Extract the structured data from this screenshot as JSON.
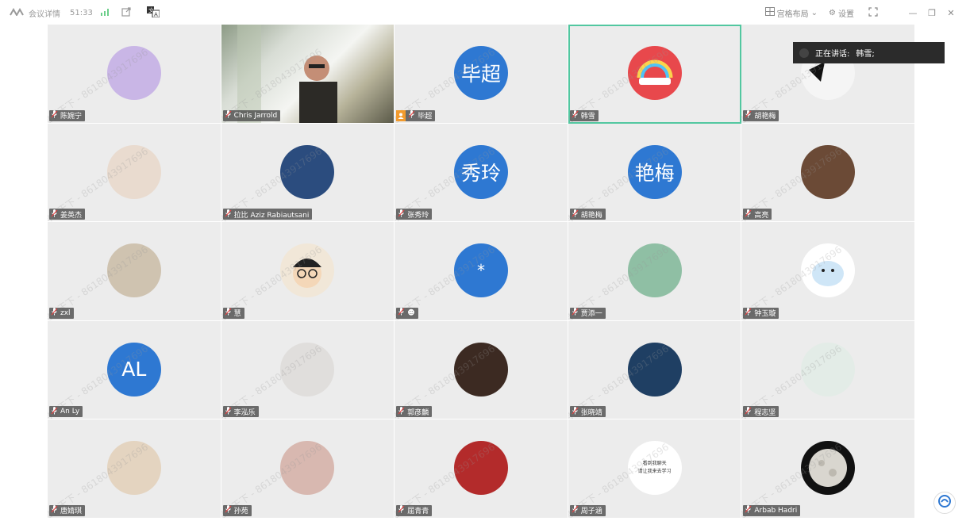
{
  "titlebar": {
    "meeting_info_label": "会议详情",
    "timer": "51:33",
    "layout_label": "宫格布局",
    "settings_label": "设置"
  },
  "speaking": {
    "label": "正在讲话:",
    "name": "韩雪;"
  },
  "watermark": "君悦天下 - 8618043917696",
  "tiles": [
    {
      "name": "陈婉宁",
      "avatar": "avatar-illustration-purple-hair",
      "color": "#c9b6e6"
    },
    {
      "name": "Chris Jarrold",
      "avatar": "camera-video",
      "color": "#8d9b86"
    },
    {
      "name": "毕超",
      "avatar_text": "毕超",
      "color": "#2e78d2",
      "host": true
    },
    {
      "name": "韩雪",
      "avatar": "avatar-rainbow",
      "color": "#e8484c",
      "active": true
    },
    {
      "name": "胡艳梅",
      "avatar": "avatar-black-cat",
      "color": "#f5f5f5"
    },
    {
      "name": "姜英杰",
      "avatar": "avatar-woman-photo",
      "color": "#e9dbcf"
    },
    {
      "name": "拉比 Aziz Rabiautsani",
      "avatar": "avatar-soccer-player",
      "color": "#2b4c7e"
    },
    {
      "name": "张秀玲",
      "avatar_text": "秀玲",
      "color": "#2e78d2"
    },
    {
      "name": "胡艳梅",
      "avatar_text": "艳梅",
      "color": "#2e78d2"
    },
    {
      "name": "高亮",
      "avatar": "avatar-woman-office",
      "color": "#6b4a36"
    },
    {
      "name": "zxl",
      "avatar": "avatar-cat-hat",
      "color": "#cfc3b0"
    },
    {
      "name": "慧",
      "avatar": "avatar-cartoon-man-glasses",
      "color": "#f1e7d8"
    },
    {
      "name": "☻",
      "avatar_text": "*",
      "color": "#2e78d2"
    },
    {
      "name": "贾添一",
      "avatar": "avatar-green-illustration",
      "color": "#8fbfa4"
    },
    {
      "name": "钟玉璇",
      "avatar": "avatar-cartoon-whale",
      "color": "#ffffff"
    },
    {
      "name": "An Ly",
      "avatar_text": "AL",
      "color": "#2e78d2"
    },
    {
      "name": "李泓乐",
      "avatar": "avatar-white-dog",
      "color": "#e0dedc"
    },
    {
      "name": "郭彦麟",
      "avatar": "avatar-man-thumbs-up",
      "color": "#3c2a22"
    },
    {
      "name": "张晓靖",
      "avatar": "avatar-man-portrait",
      "color": "#1f3f63"
    },
    {
      "name": "程志坚",
      "avatar": "avatar-calligraphy-card",
      "color": "#e3ece7"
    },
    {
      "name": "唐婧琪",
      "avatar": "avatar-fluffy-pet",
      "color": "#e4d4c0"
    },
    {
      "name": "孙苑",
      "avatar": "avatar-hamster",
      "color": "#d8b8b0"
    },
    {
      "name": "屈青青",
      "avatar": "avatar-christmas-toy",
      "color": "#b32b2b"
    },
    {
      "name": "周子涵",
      "avatar": "avatar-text-card",
      "color": "#ffffff",
      "card_text_1": "看到我聊天",
      "card_text_2": "请让我来去学习"
    },
    {
      "name": "Arbab Hadri",
      "avatar": "avatar-moon",
      "color": "#111111"
    }
  ]
}
